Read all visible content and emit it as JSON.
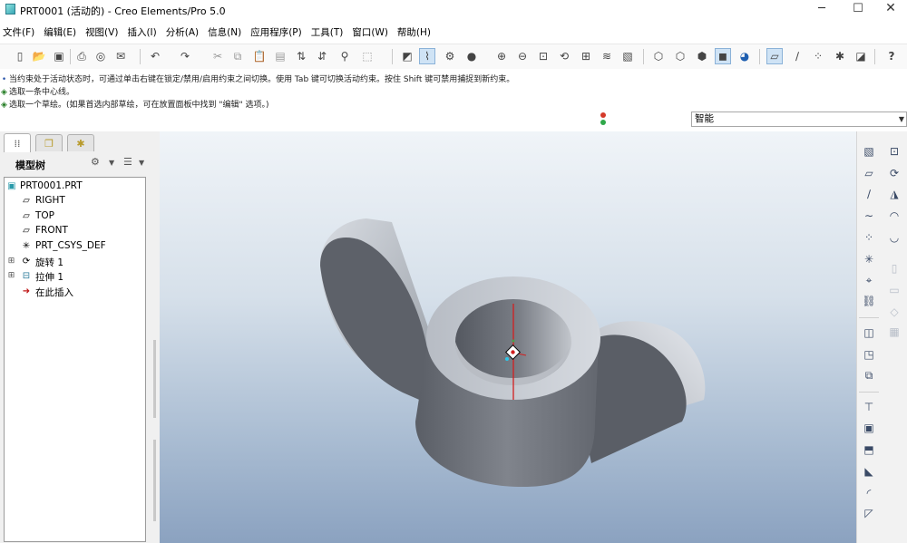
{
  "window": {
    "title": "PRT0001 (活动的) - Creo Elements/Pro 5.0",
    "minimize_glyph": "─",
    "maximize_glyph": "☐",
    "close_glyph": "✕"
  },
  "menu": [
    "文件(F)",
    "编辑(E)",
    "视图(V)",
    "插入(I)",
    "分析(A)",
    "信息(N)",
    "应用程序(P)",
    "工具(T)",
    "窗口(W)",
    "帮助(H)"
  ],
  "toolbar_icons": [
    "new-file-icon",
    "open-folder-icon",
    "save-icon",
    "print-icon",
    "preview-icon",
    "email-icon",
    "undo-icon",
    "redo-icon",
    "cut-icon",
    "copy-icon",
    "paste-icon",
    "paste-special-icon",
    "regenerate-icon",
    "regenerate-manager-icon",
    "find-icon",
    "select-box-icon",
    "sketch-icon",
    "datum-display-icon",
    "axis-display-icon",
    "shading-icon",
    "zoom-in-icon",
    "zoom-out-icon",
    "refit-icon",
    "reorient-icon",
    "saved-views-icon",
    "layers-icon",
    "view-manager-icon",
    "wireframe-icon",
    "hidden-line-icon",
    "no-hidden-icon",
    "shaded-icon",
    "enhanced-realism-icon",
    "datum-planes-icon",
    "datum-axes-icon",
    "datum-points-icon",
    "coordinate-systems-icon",
    "annotation-icon",
    "context-help-icon"
  ],
  "messages": [
    {
      "icon": "bullet-icon",
      "text": "当约束处于活动状态时，可通过单击右键在锁定/禁用/启用约束之间切换。使用 Tab 键可切换活动约束。按住 Shift 键可禁用捕捉到新约束。"
    },
    {
      "icon": "diamond-arrow-icon",
      "text": "选取一条中心线。"
    },
    {
      "icon": "diamond-arrow-icon",
      "text": "选取一个草绘。(如果首选内部草绘，可在放置面板中找到 \"编辑\" 选项。)"
    }
  ],
  "filter": {
    "value": "智能"
  },
  "model_tree": {
    "header": "模型树",
    "settings_glyph": "⚙",
    "show_glyph": "☰",
    "items": [
      {
        "label": "PRT0001.PRT",
        "icon": "part-icon",
        "expandable": false
      },
      {
        "label": "RIGHT",
        "icon": "datum-plane-icon",
        "expandable": false
      },
      {
        "label": "TOP",
        "icon": "datum-plane-icon",
        "expandable": false
      },
      {
        "label": "FRONT",
        "icon": "datum-plane-icon",
        "expandable": false
      },
      {
        "label": "PRT_CSYS_DEF",
        "icon": "csys-icon",
        "expandable": false
      },
      {
        "label": "旋转 1",
        "icon": "revolve-icon",
        "expandable": true
      },
      {
        "label": "拉伸 1",
        "icon": "extrude-icon",
        "expandable": true
      },
      {
        "label": "在此插入",
        "icon": "insert-here-arrow-icon",
        "expandable": false
      }
    ]
  },
  "colors": {
    "model_face_light": "#c9ced6",
    "model_face_dark": "#5c606a",
    "axis_line": "#d21f1f",
    "viewport_top": "#f0f4f8",
    "viewport_bottom": "#8ba2c0"
  },
  "right_toolbar_icons": [
    "sketch-plane-icon",
    "datum-plane-tool-icon",
    "datum-axis-tool-icon",
    "datum-curve-icon",
    "datum-point-icon",
    "csys-tool-icon",
    "analysis-feature-icon",
    "hole-icon",
    "shell-icon",
    "rib-icon",
    "draft-icon",
    "round-icon",
    "chamfer-icon",
    "extrude-tool-icon",
    "revolve-tool-icon",
    "sweep-icon",
    "blend-icon",
    "pattern-icon",
    "mirror-icon",
    "merge-icon"
  ]
}
